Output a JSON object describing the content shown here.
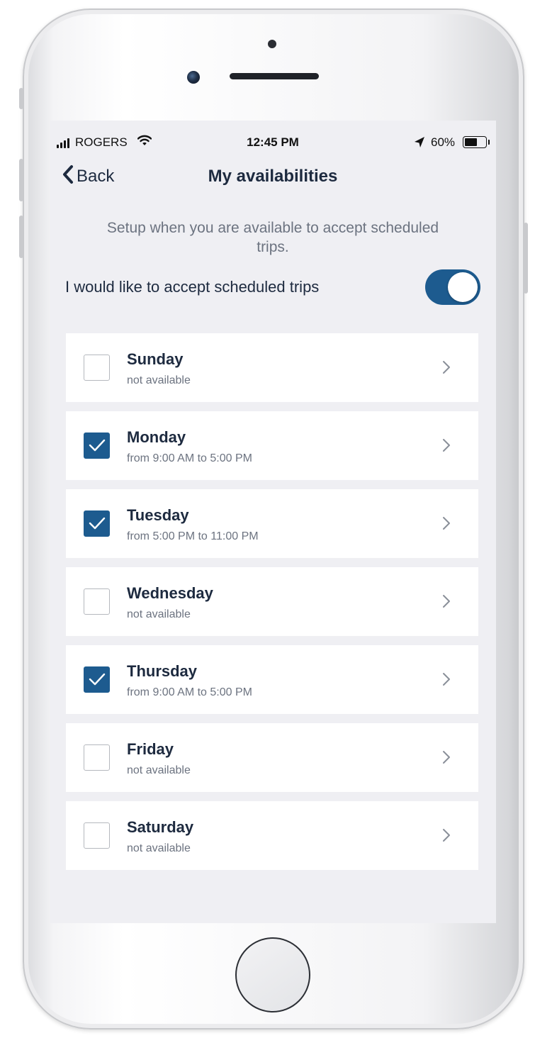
{
  "status_bar": {
    "carrier": "ROGERS",
    "time": "12:45 PM",
    "battery_percent": "60%",
    "battery_level": 0.6,
    "icons": [
      "signal-icon",
      "wifi-icon",
      "location-arrow-icon",
      "battery-icon"
    ]
  },
  "nav": {
    "back_label": "Back",
    "title": "My availabilities"
  },
  "description": "Setup when you are available to accept scheduled trips.",
  "scheduled_trips": {
    "label": "I would like to accept scheduled trips",
    "enabled": true
  },
  "days": [
    {
      "name": "Sunday",
      "detail": "not available",
      "checked": false
    },
    {
      "name": "Monday",
      "detail": "from 9:00 AM to 5:00 PM",
      "checked": true
    },
    {
      "name": "Tuesday",
      "detail": "from 5:00 PM to 11:00 PM",
      "checked": true
    },
    {
      "name": "Wednesday",
      "detail": "not available",
      "checked": false
    },
    {
      "name": "Thursday",
      "detail": "from 9:00 AM to 5:00 PM",
      "checked": true
    },
    {
      "name": "Friday",
      "detail": "not available",
      "checked": false
    },
    {
      "name": "Saturday",
      "detail": "not available",
      "checked": false
    }
  ],
  "colors": {
    "accent": "#1d5b8f",
    "text_primary": "#1d2a3f",
    "text_secondary": "#6c7380",
    "background": "#efeff3"
  }
}
